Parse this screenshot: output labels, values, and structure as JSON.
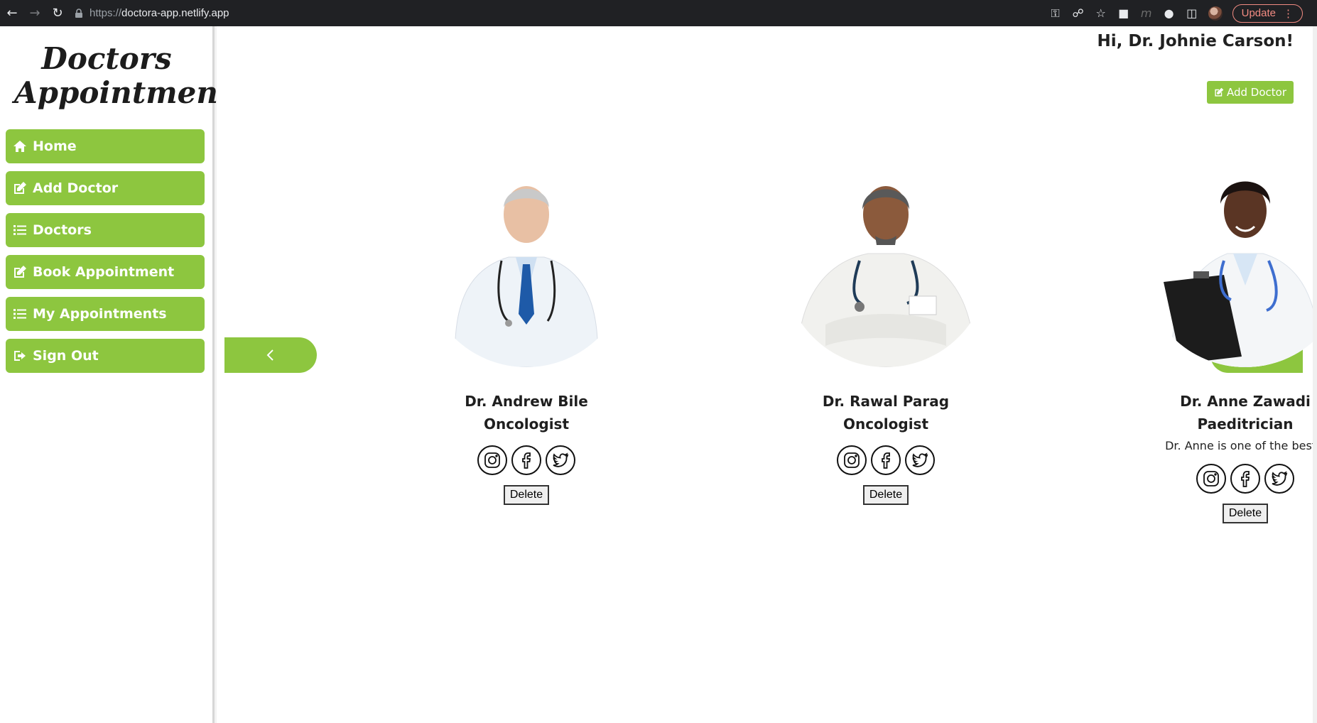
{
  "browser": {
    "url_protocol": "https://",
    "url_host": "doctora-app.netlify.app",
    "update_label": "Update"
  },
  "sidebar": {
    "logo_line1": "Doctors",
    "logo_line2": "Appointment",
    "items": [
      {
        "label": "Home",
        "icon": "home-icon"
      },
      {
        "label": "Add Doctor",
        "icon": "edit-icon"
      },
      {
        "label": "Doctors",
        "icon": "list-icon"
      },
      {
        "label": "Book Appointment",
        "icon": "edit-icon"
      },
      {
        "label": "My Appointments",
        "icon": "list-icon"
      },
      {
        "label": "Sign Out",
        "icon": "sign-out-icon"
      }
    ]
  },
  "header": {
    "greeting": "Hi, Dr. Johnie Carson!",
    "add_doctor_label": "Add Doctor"
  },
  "doctors": [
    {
      "name": "Dr. Andrew Bile",
      "specialty": "Oncologist",
      "description": "",
      "delete_label": "Delete"
    },
    {
      "name": "Dr. Rawal Parag",
      "specialty": "Oncologist",
      "description": "",
      "delete_label": "Delete"
    },
    {
      "name": "Dr. Anne Zawadi",
      "specialty": "Paeditrician",
      "description": "Dr. Anne is one of the best!!",
      "delete_label": "Delete"
    }
  ],
  "colors": {
    "accent": "#8dc63f",
    "browser_bar": "#202124"
  }
}
